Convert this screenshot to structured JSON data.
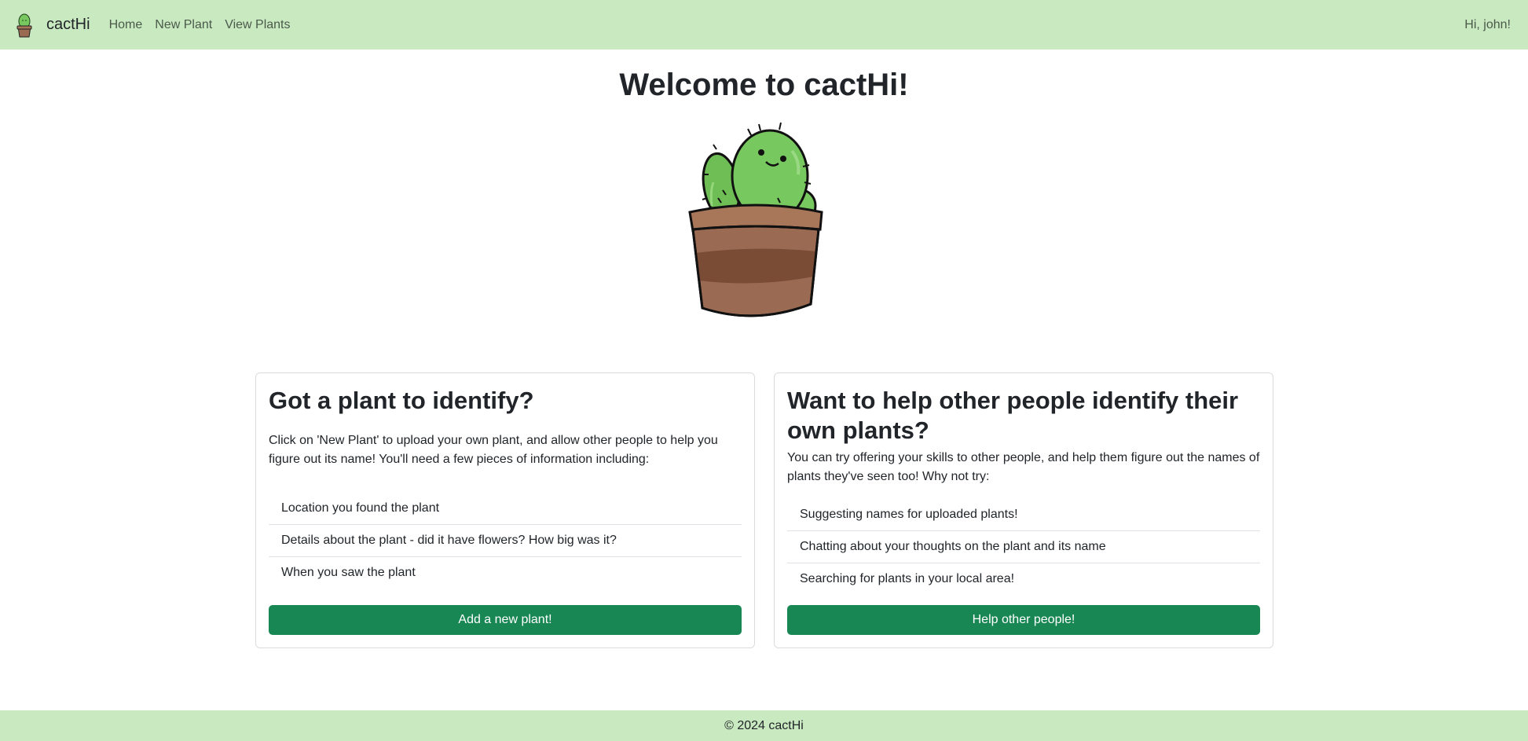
{
  "nav": {
    "brand": "cactHi",
    "links": [
      "Home",
      "New Plant",
      "View Plants"
    ],
    "greeting": "Hi, john!"
  },
  "main": {
    "title": "Welcome to cactHi!"
  },
  "cards": [
    {
      "title": "Got a plant to identify?",
      "text": "Click on 'New Plant' to upload your own plant, and allow other people to help you figure out its name! You'll need a few pieces of information including:",
      "items": [
        "Location you found the plant",
        "Details about the plant - did it have flowers? How big was it?",
        "When you saw the plant"
      ],
      "button": "Add a new plant!"
    },
    {
      "title": "Want to help other people identify their own plants?",
      "text": "You can try offering your skills to other people, and help them figure out the names of plants they've seen too! Why not try:",
      "items": [
        "Suggesting names for uploaded plants!",
        "Chatting about your thoughts on the plant and its name",
        "Searching for plants in your local area!"
      ],
      "button": "Help other people!"
    }
  ],
  "footer": {
    "text": "© 2024 cactHi"
  },
  "colors": {
    "nav_bg": "#c9e9c0",
    "button": "#198754",
    "cactus": "#78c860",
    "pot": "#9a6b52"
  },
  "icons": {
    "logo": "cactus-logo-icon",
    "hero": "cactus-illustration"
  }
}
